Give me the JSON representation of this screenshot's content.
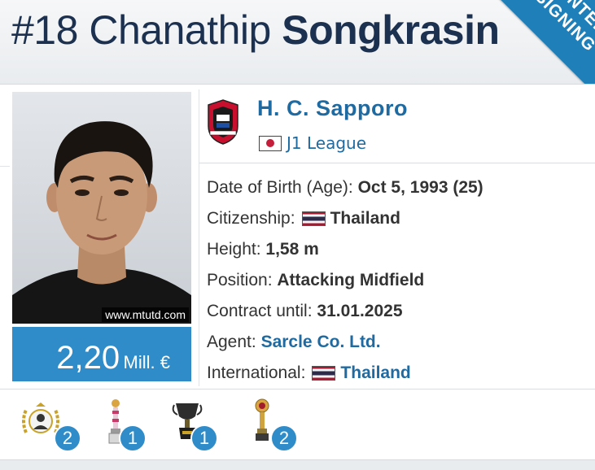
{
  "player": {
    "number": "#18",
    "first_name": "Chanathip",
    "last_name": "Songkrasin"
  },
  "ribbon": {
    "line1": "WINTER",
    "line2": "SIGNING"
  },
  "photo": {
    "watermark": "www.mtutd.com"
  },
  "market_value": {
    "amount": "2,20",
    "unit": "Mill. €"
  },
  "club": {
    "name": "H. C. Sapporo",
    "league": "J1 League"
  },
  "info": {
    "dob_label": "Date of Birth (Age):",
    "dob_value": "Oct 5, 1993 (25)",
    "citizenship_label": "Citizenship:",
    "citizenship_value": "Thailand",
    "height_label": "Height:",
    "height_value": "1,58 m",
    "position_label": "Position:",
    "position_value": "Attacking Midfield",
    "contract_label": "Contract until:",
    "contract_value": "31.01.2025",
    "agent_label": "Agent:",
    "agent_value": "Sarcle Co. Ltd.",
    "international_label": "International:",
    "international_value": "Thailand"
  },
  "trophies": [
    {
      "icon": "player-award-icon",
      "count": "2"
    },
    {
      "icon": "trophy-award-icon",
      "count": "1"
    },
    {
      "icon": "cup-trophy-icon",
      "count": "1"
    },
    {
      "icon": "golden-trophy-icon",
      "count": "2"
    }
  ],
  "colors": {
    "accent": "#2f8cc8",
    "link": "#1f6aa0",
    "title": "#1c3150"
  }
}
